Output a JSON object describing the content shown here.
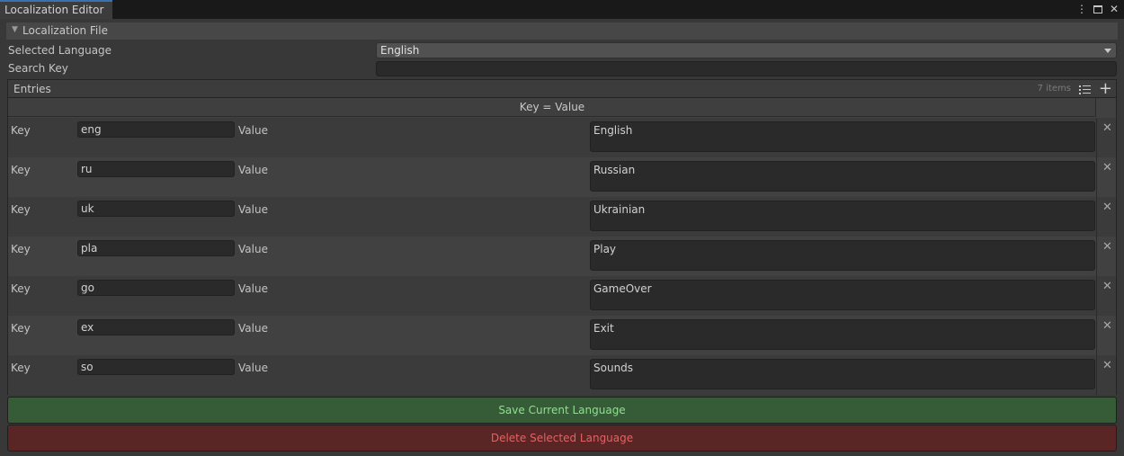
{
  "window": {
    "tab_title": "Localization Editor",
    "icons": [
      "kebab-menu-icon",
      "maximize-icon",
      "close-icon"
    ]
  },
  "foldout": {
    "label": "Localization File"
  },
  "selected_language": {
    "label": "Selected Language",
    "value": "English"
  },
  "search": {
    "label": "Search Key",
    "value": ""
  },
  "entries": {
    "title": "Entries",
    "count": "7 items",
    "column_header": "Key = Value",
    "key_label": "Key",
    "value_label": "Value",
    "items": [
      {
        "key": "eng",
        "value": "English"
      },
      {
        "key": "ru",
        "value": "Russian"
      },
      {
        "key": "uk",
        "value": "Ukrainian"
      },
      {
        "key": "pla",
        "value": "Play"
      },
      {
        "key": "go",
        "value": "GameOver"
      },
      {
        "key": "ex",
        "value": "Exit"
      },
      {
        "key": "so",
        "value": "Sounds"
      }
    ]
  },
  "buttons": {
    "save": "Save Current Language",
    "delete": "Delete Selected Language"
  },
  "colors": {
    "save_bg": "#355c36",
    "save_text": "#8ee08e",
    "delete_bg": "#5a2525",
    "delete_text": "#e06464",
    "tab_accent": "#3a72b0"
  }
}
